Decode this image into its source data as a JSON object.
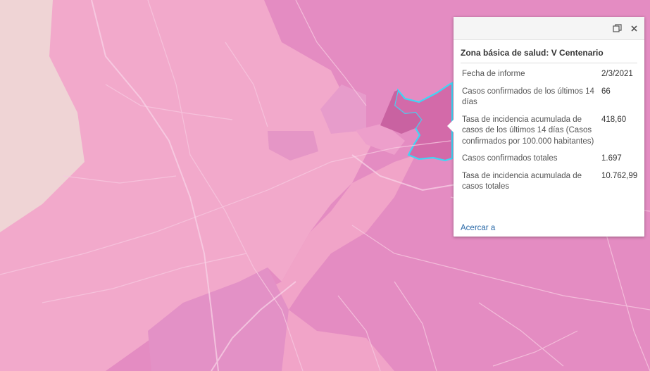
{
  "popup": {
    "title": "Zona básica de salud: V Centenario",
    "rows": [
      {
        "label": "Fecha de informe",
        "value": "2/3/2021"
      },
      {
        "label": "Casos confirmados de los últimos 14 días",
        "value": "66"
      },
      {
        "label": "Tasa de incidencia acumulada de casos de los últimos 14 días (Casos confirmados por 100.000 habitantes)",
        "value": "418,60"
      },
      {
        "label": "Casos confirmados totales",
        "value": "1.697"
      },
      {
        "label": "Tasa de incidencia acumulada de casos totales",
        "value": "10.762,99"
      }
    ],
    "zoom_label": "Acercar a",
    "icons": {
      "dock": "dock-icon",
      "close": "close-icon"
    }
  },
  "colors": {
    "map_dark": "#e48cc2",
    "map_light": "#f2a9cb",
    "map_pale": "#f0d7d7",
    "selected_fill": "#d36aa9",
    "selected_outline": "#3fd6f5"
  }
}
